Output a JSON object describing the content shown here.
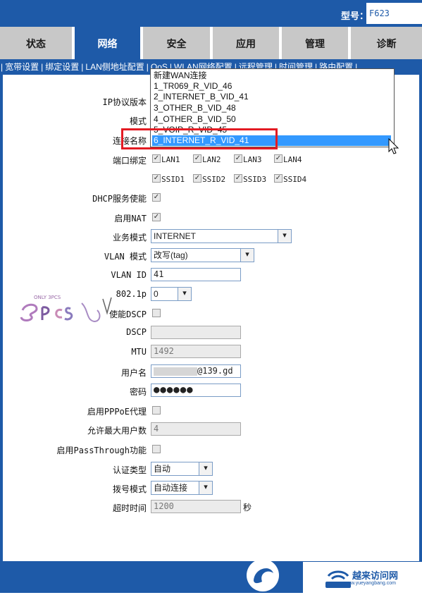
{
  "header": {
    "model_label": "型号：",
    "model_value": "F623"
  },
  "tabs": [
    "状态",
    "网络",
    "安全",
    "应用",
    "管理",
    "诊断"
  ],
  "active_tab": "网络",
  "subnav": [
    "宽带设置",
    "绑定设置",
    "LAN侧地址配置",
    "QoS",
    "WLAN网络配置",
    "远程管理",
    "时间管理",
    "路由配置"
  ],
  "form": {
    "ip_protocol_label": "IP协议版本",
    "mode_label": "模式",
    "conn_name_label": "连接名称",
    "port_binding_label": "端口绑定",
    "ports": [
      "LAN1",
      "LAN2",
      "LAN3",
      "LAN4",
      "SSID1",
      "SSID2",
      "SSID3",
      "SSID4"
    ],
    "dhcp_label": "DHCP服务使能",
    "nat_label": "启用NAT",
    "service_mode_label": "业务模式",
    "service_mode_value": "INTERNET",
    "vlan_mode_label": "VLAN 模式",
    "vlan_mode_value": "改写(tag)",
    "vlan_id_label": "VLAN ID",
    "vlan_id_value": "41",
    "p8021_label": "802.1p",
    "p8021_value": "0",
    "dscp_enable_label": "使能DSCP",
    "dscp_label": "DSCP",
    "dscp_value": "",
    "mtu_label": "MTU",
    "mtu_value": "1492",
    "username_label": "用户名",
    "username_value": "@139.gd",
    "password_label": "密码",
    "password_value": "●●●●●●",
    "pppoe_proxy_label": "启用PPPoE代理",
    "max_users_label": "允许最大用户数",
    "max_users_value": "4",
    "passthrough_label": "启用PassThrough功能",
    "auth_type_label": "认证类型",
    "auth_type_value": "自动",
    "dial_mode_label": "拨号模式",
    "dial_mode_value": "自动连接",
    "timeout_label": "超时时间",
    "timeout_value": "1200",
    "timeout_unit": "秒"
  },
  "dropdown": {
    "items": [
      "新建WAN连接",
      "1_TR069_R_VID_46",
      "2_INTERNET_B_VID_41",
      "3_OTHER_B_VID_48",
      "4_OTHER_B_VID_50",
      "5_VOIP_R_VID_45",
      "6_INTERNET_R_VID_41"
    ],
    "selected_index": 6
  },
  "watermark": {
    "brand": "越来访问网",
    "url": "www.yueyangbang.com",
    "left_text": "ONLY 3PCS"
  },
  "colors": {
    "primary": "#1e5aa8",
    "highlight": "#e31b23",
    "selected": "#3399ff"
  }
}
